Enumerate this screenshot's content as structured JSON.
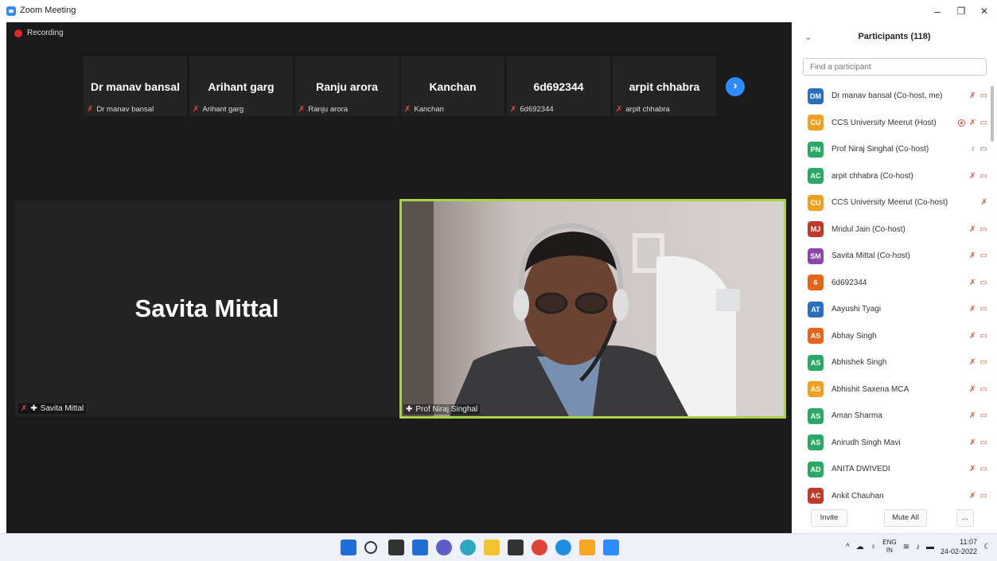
{
  "window": {
    "title": "Zoom Meeting",
    "minimize": "–",
    "restore": "❐",
    "close": "✕"
  },
  "meeting": {
    "recording_label": "Recording",
    "thumbnails": [
      {
        "name": "Dr manav bansal",
        "label": "Dr manav bansal"
      },
      {
        "name": "Arihant garg",
        "label": "Arihant garg"
      },
      {
        "name": "Ranju arora",
        "label": "Ranju arora"
      },
      {
        "name": "Kanchan",
        "label": "Kanchan"
      },
      {
        "name": "6d692344",
        "label": "6d692344"
      },
      {
        "name": "arpit chhabra",
        "label": "arpit chhabra"
      }
    ],
    "next_arrow": "›",
    "tile_savita": {
      "big_name": "Savita Mittal",
      "label": "Savita Mittal"
    },
    "tile_niraj": {
      "label": "Prof Niraj Singhal"
    }
  },
  "participants": {
    "title": "Participants (118)",
    "collapse_icon": "⌄",
    "search_placeholder": "Find a participant",
    "list": [
      {
        "initials": "DM",
        "color": "#2a6fbf",
        "name": "Dr manav bansal (Co-host, me)"
      },
      {
        "initials": "CU",
        "color": "#f0a020",
        "name": "CCS University Meerut (Host)"
      },
      {
        "initials": "PN",
        "color": "#2aa866",
        "name": "Prof Niraj Singhal (Co-host)"
      },
      {
        "initials": "AC",
        "color": "#2aa866",
        "name": "arpit chhabra (Co-host)"
      },
      {
        "initials": "CU",
        "color": "#f0a020",
        "name": "CCS University Meerut (Co-host)"
      },
      {
        "initials": "MJ",
        "color": "#c0392b",
        "name": "Mridul Jain (Co-host)"
      },
      {
        "initials": "SM",
        "color": "#8e44ad",
        "name": "Savita Mittal (Co-host)"
      },
      {
        "initials": "6",
        "color": "#e8641a",
        "name": "6d692344"
      },
      {
        "initials": "AT",
        "color": "#2a6fbf",
        "name": "Aayushi Tyagi"
      },
      {
        "initials": "AS",
        "color": "#e8641a",
        "name": "Abhay Singh"
      },
      {
        "initials": "AS",
        "color": "#2aa866",
        "name": "Abhishek Singh"
      },
      {
        "initials": "AS",
        "color": "#f0a020",
        "name": "Abhishit Saxena MCA"
      },
      {
        "initials": "AS",
        "color": "#2aa866",
        "name": "Aman Sharma"
      },
      {
        "initials": "AS",
        "color": "#2aa866",
        "name": "Anirudh Singh Mavi"
      },
      {
        "initials": "AD",
        "color": "#2aa866",
        "name": "ANITA DWIVEDI"
      },
      {
        "initials": "AC",
        "color": "#c0392b",
        "name": "Ankit Chauhan"
      }
    ],
    "invite_label": "Invite",
    "mute_all_label": "Mute All",
    "more_label": "..."
  },
  "taskbar": {
    "lang_top": "ENG",
    "lang_bottom": "IN",
    "time": "11:07",
    "date": "24-02-2022"
  }
}
